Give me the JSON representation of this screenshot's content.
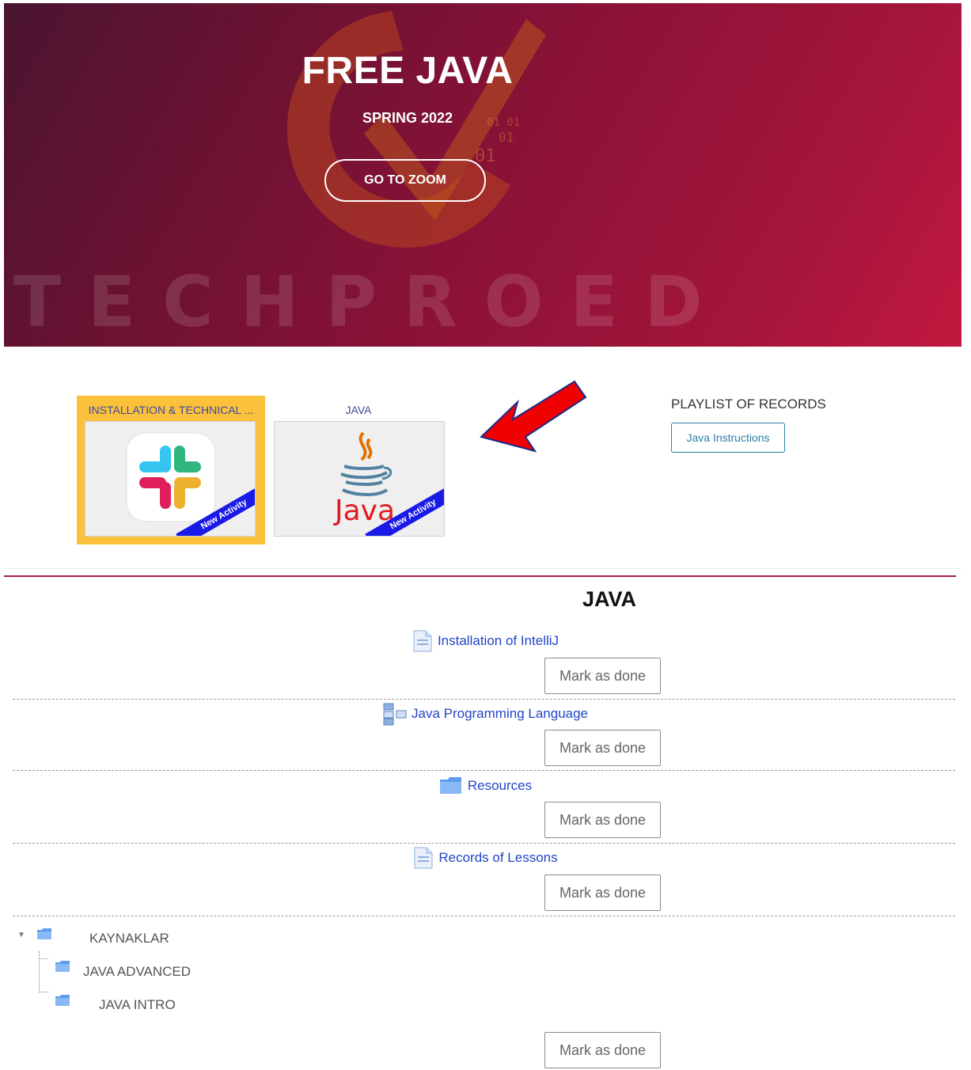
{
  "hero": {
    "title": "FREE JAVA",
    "subtitle": "SPRING 2022",
    "zoom_button": "GO TO ZOOM",
    "wordmark": "TECHPROED",
    "colors": {
      "start": "#4a1530",
      "end": "#c2183f"
    }
  },
  "cards": [
    {
      "title": "INSTALLATION & TECHNICAL ...",
      "icon": "slack-icon",
      "ribbon": "New Activity",
      "highlight": "#fcc13a"
    },
    {
      "title": "JAVA",
      "icon": "java-icon",
      "ribbon": "New Activity",
      "logo_text": "Java"
    }
  ],
  "playlist": {
    "title": "PLAYLIST OF RECORDS",
    "button": "Java Instructions"
  },
  "section": {
    "title": "JAVA",
    "activities": [
      {
        "label": "Installation of IntelliJ",
        "icon": "page-icon",
        "mark": "Mark as done"
      },
      {
        "label": "Java Programming Language",
        "icon": "structure-icon",
        "mark": "Mark as done"
      },
      {
        "label": "Resources",
        "icon": "folder-icon",
        "mark": "Mark as done"
      },
      {
        "label": "Records of Lessons",
        "icon": "page-icon",
        "mark": "Mark as done"
      }
    ],
    "tree": {
      "root": "KAYNAKLAR",
      "children": [
        "JAVA ADVANCED",
        "JAVA INTRO"
      ],
      "mark": "Mark as done"
    }
  }
}
